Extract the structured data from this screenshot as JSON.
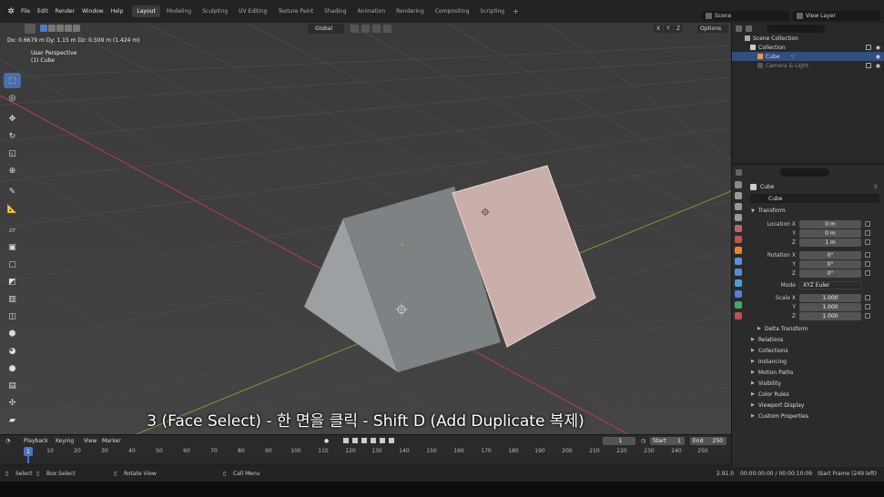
{
  "topbar": {
    "menu": [
      "File",
      "Edit",
      "Render",
      "Window",
      "Help"
    ],
    "workspaces": [
      "Layout",
      "Modeling",
      "Sculpting",
      "UV Editing",
      "Texture Paint",
      "Shading",
      "Animation",
      "Rendering",
      "Compositing",
      "Scripting"
    ],
    "active_workspace": "Layout",
    "scene": "Scene",
    "view_layer": "View Layer"
  },
  "viewport": {
    "delta_readout": "Dx: 0.6679 m  Dy: 1.15 m  Dz: 0.509 m (1.424 m)",
    "view_name": "User Perspective",
    "object_label": "(1) Cube",
    "transform_orientation": "Global",
    "axes": [
      "X",
      "Y",
      "Z"
    ],
    "options_label": "Options",
    "subtitle": "3 (Face Select) - 한 면을 클릭 - Shift D (Add Duplicate 복제)"
  },
  "outliner": {
    "rows": [
      {
        "label": "Scene Collection"
      },
      {
        "label": "Collection"
      },
      {
        "label": "Cube"
      },
      {
        "label": "Camera & Light"
      }
    ]
  },
  "properties": {
    "object_name": "Cube",
    "data_name": "Cube",
    "transform_label": "Transform",
    "location": {
      "label": "Location X",
      "x": "0 m",
      "y": "0 m",
      "z": "1 m"
    },
    "rotation": {
      "label": "Rotation X",
      "x": "0°",
      "y": "0°",
      "z": "0°"
    },
    "mode": {
      "label": "Mode",
      "value": "XYZ Euler"
    },
    "scale": {
      "label": "Scale X",
      "x": "1.000",
      "y": "1.000",
      "z": "1.000"
    },
    "axis_y": "Y",
    "axis_z": "Z",
    "delta_transform": "Delta Transform",
    "sections": [
      "Relations",
      "Collections",
      "Instancing",
      "Motion Paths",
      "Visibility",
      "Color Rules",
      "Viewport Display",
      "Custom Properties"
    ]
  },
  "timeline": {
    "playback": "Playback",
    "keying": "Keying",
    "view": "View",
    "marker": "Marker",
    "current_frame": "1",
    "start_label": "Start",
    "start": "1",
    "end_label": "End",
    "end": "250",
    "ruler_current": "1",
    "ticks": [
      "10",
      "20",
      "30",
      "40",
      "50",
      "60",
      "70",
      "80",
      "90",
      "100",
      "110",
      "120",
      "130",
      "140",
      "150",
      "160",
      "170",
      "180",
      "190",
      "200",
      "210",
      "220",
      "230",
      "240",
      "250"
    ]
  },
  "statusbar": {
    "select": "Select",
    "box_select": "Box Select",
    "rotate_view": "Rotate View",
    "call_menu": "Call Menu",
    "version": "2.91.0",
    "timecode": "00:00:00:00 / 00:00:10:09",
    "start_frame": "Start Frame (249 left)"
  },
  "colors": {
    "accent": "#4b74c6",
    "viewport_bg": "#3d3d3d",
    "selected_face": "#c9aeaa",
    "x_axis": "#b83c4a",
    "y_axis": "#7a9a2e"
  }
}
